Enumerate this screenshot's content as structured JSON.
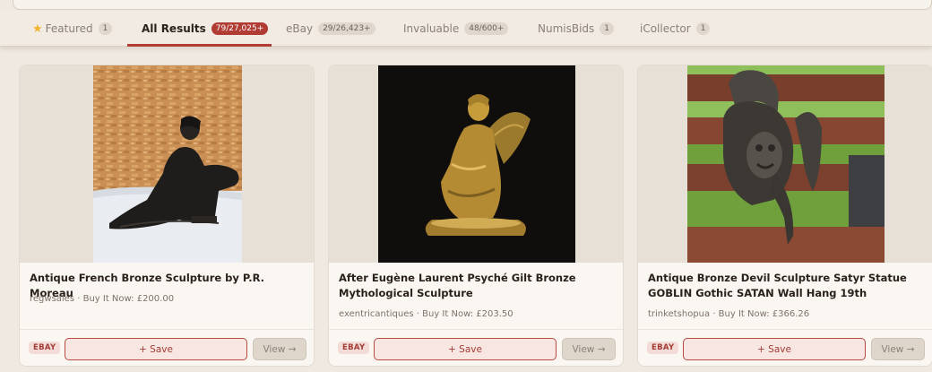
{
  "tabs": [
    {
      "label": "Featured",
      "count": "1",
      "icon": "star-icon"
    },
    {
      "label": "All Results",
      "count": "79/27,025+",
      "active": true
    },
    {
      "label": "eBay",
      "count": "29/26,423+"
    },
    {
      "label": "Invaluable",
      "count": "48/600+"
    },
    {
      "label": "NumisBids",
      "count": "1"
    },
    {
      "label": "iCollector",
      "count": "1"
    }
  ],
  "cards": [
    {
      "title": "Antique French Bronze Sculpture by P.R. Moreau",
      "meta": "regwsales · Buy It Now: £200.00",
      "source": "EBAY",
      "save_label": "+ Save",
      "view_label": "View →"
    },
    {
      "title": "After Eugène Laurent Psyché Gilt Bronze Mythological Sculpture",
      "meta": "exentricantiques · Buy It Now: £203.50",
      "source": "EBAY",
      "save_label": "+ Save",
      "view_label": "View →"
    },
    {
      "title": "Antique Bronze Devil Sculpture Satyr Statue GOBLIN Gothic SATAN Wall Hang 19th",
      "meta": "trinketshopua · Buy It Now: £366.26",
      "source": "EBAY",
      "save_label": "+ Save",
      "view_label": "View →"
    }
  ],
  "colors": {
    "accent": "#b13c34",
    "page_bg": "#efe9e1",
    "card_bg": "#faf7f3"
  }
}
